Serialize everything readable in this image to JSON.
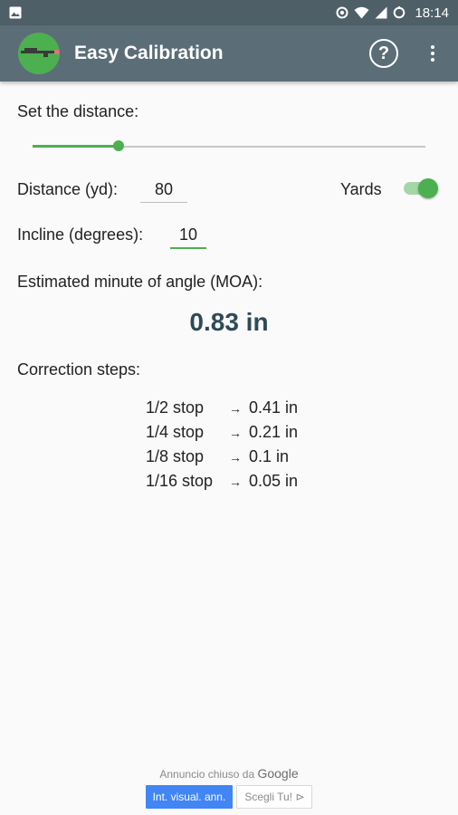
{
  "status_bar": {
    "time": "18:14",
    "icons": [
      "image-icon",
      "sync-icon",
      "wifi-icon",
      "signal-icon",
      "battery-icon"
    ]
  },
  "app_bar": {
    "title": "Easy Calibration",
    "help_label": "?"
  },
  "distance_section": {
    "label": "Set the distance:",
    "slider_fraction": 0.22
  },
  "distance_field": {
    "label": "Distance (yd):",
    "value": "80"
  },
  "units_toggle": {
    "label": "Yards",
    "on": true
  },
  "incline_field": {
    "label": "Incline (degrees):",
    "value": "10"
  },
  "moa": {
    "label": "Estimated minute of angle (MOA):",
    "value": "0.83 in"
  },
  "correction": {
    "label": "Correction steps:",
    "steps": [
      {
        "step": "1/2 stop",
        "arrow": "→",
        "value": "0.41 in"
      },
      {
        "step": "1/4 stop",
        "arrow": "→",
        "value": "0.21 in"
      },
      {
        "step": "1/8 stop",
        "arrow": "→",
        "value": "0.1 in"
      },
      {
        "step": "1/16 stop",
        "arrow": "→",
        "value": "0.05 in"
      }
    ]
  },
  "ad": {
    "closed_text": "Annuncio chiuso da",
    "google": "Google",
    "button_primary": "Int. visual. ann.",
    "button_secondary": "Scegli Tu! ⊳"
  },
  "colors": {
    "accent": "#4caf50",
    "app_bar": "#5b6d77",
    "status_bar": "#4f5f68",
    "result": "#2e4a58"
  }
}
